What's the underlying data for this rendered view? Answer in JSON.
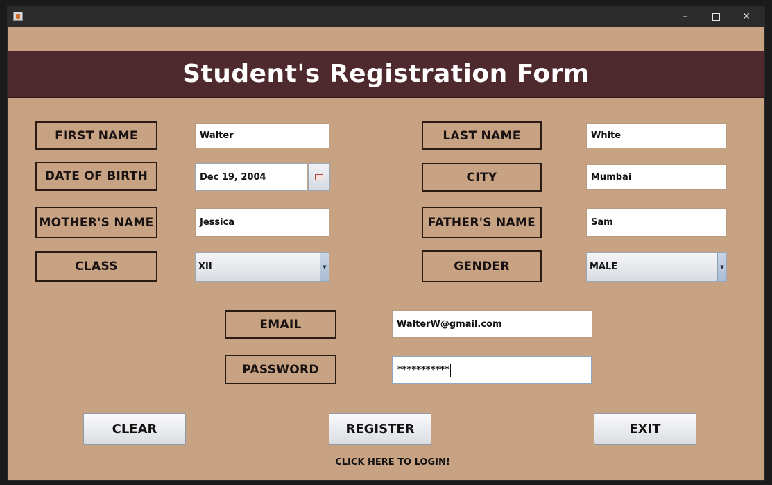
{
  "window": {
    "minimize_glyph": "–",
    "close_glyph": "✕",
    "app_icon": "java-cup-icon"
  },
  "form": {
    "title": "Student's Registration Form",
    "first_name": {
      "label": "FIRST NAME",
      "value": "Walter"
    },
    "last_name": {
      "label": "LAST NAME",
      "value": "White"
    },
    "dob": {
      "label": "DATE OF BIRTH",
      "value": "Dec 19, 2004"
    },
    "city": {
      "label": "CITY",
      "value": "Mumbai"
    },
    "mother_name": {
      "label": "MOTHER'S NAME",
      "value": "Jessica"
    },
    "father_name": {
      "label": "FATHER'S NAME",
      "value": "Sam"
    },
    "class": {
      "label": "CLASS",
      "value": "XII"
    },
    "gender": {
      "label": "GENDER",
      "value": "MALE"
    },
    "email": {
      "label": "EMAIL",
      "value": "WalterW@gmail.com"
    },
    "password": {
      "label": "PASSWORD",
      "value": "***********"
    }
  },
  "buttons": {
    "clear": "CLEAR",
    "register": "REGISTER",
    "exit": "EXIT"
  },
  "login_link": "CLICK HERE TO LOGIN!",
  "colors": {
    "background": "#c7a383",
    "banner": "#4e2a2e",
    "titlebar": "#2b2b2b"
  }
}
